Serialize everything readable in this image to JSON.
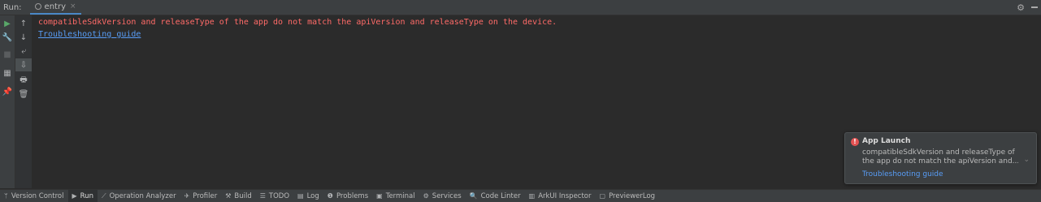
{
  "run_header": {
    "title": "Run:",
    "tab_label": "entry",
    "tab_close": "×",
    "settings_icon": "⚙"
  },
  "side_icons": {
    "run": "▶",
    "build": "🔧",
    "stop": "■",
    "layout": "▦",
    "pin": "📌"
  },
  "tool_icons": {
    "up": "↑",
    "down": "↓",
    "wrap": "⤶",
    "scroll_end": "⇩",
    "print": "🖶",
    "clear": "🗑"
  },
  "console": {
    "error_line": "compatibleSdkVersion and releaseType of the app do not match the apiVersion and releaseType on the device.",
    "link_text": "Troubleshooting guide"
  },
  "notification": {
    "icon": "!",
    "title": "App Launch",
    "body_line1": "compatibleSdkVersion and releaseType of",
    "body_line2": "the app do not match the apiVersion and...",
    "link": "Troubleshooting guide",
    "chevron": "⌄"
  },
  "status_tabs": [
    {
      "icon": "ᛘ",
      "label": "Version Control"
    },
    {
      "icon": "▶",
      "label": "Run"
    },
    {
      "icon": "⟋",
      "label": "Operation Analyzer"
    },
    {
      "icon": "✈",
      "label": "Profiler"
    },
    {
      "icon": "⚒",
      "label": "Build"
    },
    {
      "icon": "☰",
      "label": "TODO"
    },
    {
      "icon": "▤",
      "label": "Log"
    },
    {
      "icon": "❶",
      "label": "Problems"
    },
    {
      "icon": "▣",
      "label": "Terminal"
    },
    {
      "icon": "⚙",
      "label": "Services"
    },
    {
      "icon": "🔍",
      "label": "Code Linter"
    },
    {
      "icon": "▥",
      "label": "ArkUI Inspector"
    },
    {
      "icon": "▢",
      "label": "PreviewerLog"
    }
  ]
}
